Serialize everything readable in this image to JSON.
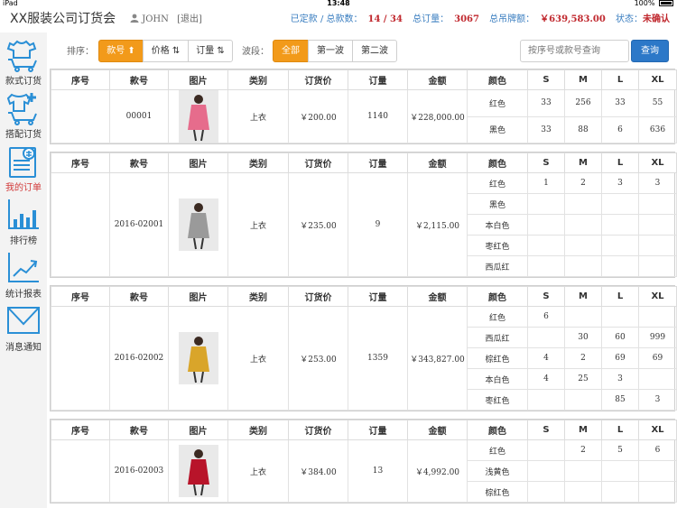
{
  "statusbar": {
    "carrier": "iPad",
    "time": "13:48",
    "battery": "100%"
  },
  "header": {
    "title": "XX服装公司订货会",
    "user": "JOHN",
    "logout": "[退出]",
    "stats": {
      "booked_label": "已定款 / 总款数：",
      "booked_value": "14 / 34",
      "total_qty_label": "总订量：",
      "total_qty_value": "3067",
      "total_amount_label": "总吊牌额：",
      "total_amount_value": "￥639,583.00",
      "status_label": "状态：",
      "status_value": "未确认"
    }
  },
  "sidebar": {
    "items": [
      {
        "label": "款式订货",
        "icon": "shirt-cart-icon"
      },
      {
        "label": "搭配订货",
        "icon": "outfit-cart-icon"
      },
      {
        "label": "我的订单",
        "icon": "order-list-icon",
        "active": true
      },
      {
        "label": "排行榜",
        "icon": "bar-chart-icon"
      },
      {
        "label": "统计报表",
        "icon": "line-chart-icon"
      },
      {
        "label": "消息通知",
        "icon": "envelope-icon"
      }
    ]
  },
  "toolbar": {
    "sort_label": "排序：",
    "sort_buttons": [
      "款号 ⬆",
      "价格 ⇅",
      "订量 ⇅"
    ],
    "wave_label": "波段：",
    "wave_buttons": [
      "全部",
      "第一波",
      "第二波"
    ],
    "search_placeholder": "按序号或款号查询",
    "search_button": "查询"
  },
  "table_headers": [
    "序号",
    "款号",
    "图片",
    "类别",
    "订货价",
    "订量",
    "金额",
    "颜色",
    "S",
    "M",
    "L",
    "XL"
  ],
  "orders": [
    {
      "seq": "",
      "style_no": "00001",
      "category": "上衣",
      "price": "￥200.00",
      "qty": "1140",
      "amount": "￥228,000.00",
      "image_color": "#e66c8c",
      "colors": [
        {
          "name": "红色",
          "S": "33",
          "M": "256",
          "L": "33",
          "XL": "55"
        },
        {
          "name": "黑色",
          "S": "33",
          "M": "88",
          "L": "6",
          "XL": "636"
        }
      ]
    },
    {
      "seq": "",
      "style_no": "2016-02001",
      "category": "上衣",
      "price": "￥235.00",
      "qty": "9",
      "amount": "￥2,115.00",
      "image_color": "#9a9a9a",
      "colors": [
        {
          "name": "红色",
          "S": "1",
          "M": "2",
          "L": "3",
          "XL": "3"
        },
        {
          "name": "黑色",
          "S": "",
          "M": "",
          "L": "",
          "XL": ""
        },
        {
          "name": "本白色",
          "S": "",
          "M": "",
          "L": "",
          "XL": ""
        },
        {
          "name": "枣红色",
          "S": "",
          "M": "",
          "L": "",
          "XL": ""
        },
        {
          "name": "西瓜红",
          "S": "",
          "M": "",
          "L": "",
          "XL": ""
        }
      ]
    },
    {
      "seq": "",
      "style_no": "2016-02002",
      "category": "上衣",
      "price": "￥253.00",
      "qty": "1359",
      "amount": "￥343,827.00",
      "image_color": "#d9a52a",
      "colors": [
        {
          "name": "红色",
          "S": "6",
          "M": "",
          "L": "",
          "XL": ""
        },
        {
          "name": "西瓜红",
          "S": "",
          "M": "30",
          "L": "60",
          "XL": "999"
        },
        {
          "name": "棕红色",
          "S": "4",
          "M": "2",
          "L": "69",
          "XL": "69"
        },
        {
          "name": "本白色",
          "S": "4",
          "M": "25",
          "L": "3",
          "XL": ""
        },
        {
          "name": "枣红色",
          "S": "",
          "M": "",
          "L": "85",
          "XL": "3"
        }
      ]
    },
    {
      "seq": "",
      "style_no": "2016-02003",
      "category": "上衣",
      "price": "￥384.00",
      "qty": "13",
      "amount": "￥4,992.00",
      "image_color": "#b8142a",
      "colors": [
        {
          "name": "红色",
          "S": "",
          "M": "2",
          "L": "5",
          "XL": "6"
        },
        {
          "name": "浅黄色",
          "S": "",
          "M": "",
          "L": "",
          "XL": ""
        },
        {
          "name": "棕红色",
          "S": "",
          "M": "",
          "L": "",
          "XL": ""
        }
      ]
    }
  ],
  "colors": {
    "accent_orange": "#f29a1a",
    "primary_blue": "#2c78c8",
    "alert_red": "#c0272d",
    "icon_blue": "#2a8fd6"
  }
}
